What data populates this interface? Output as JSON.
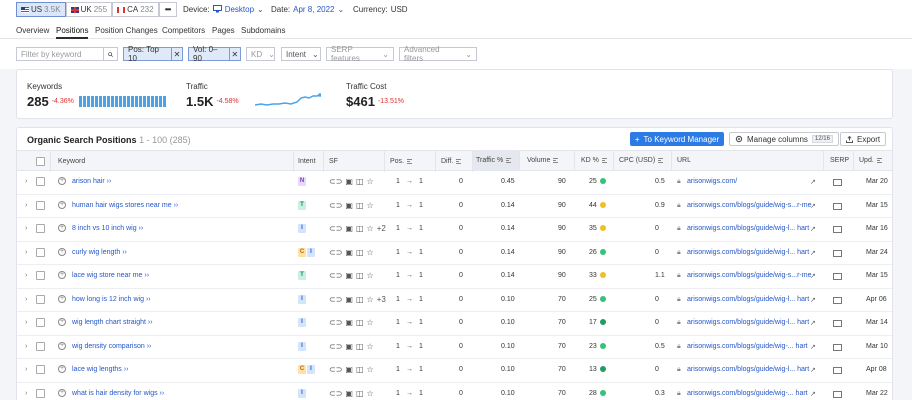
{
  "databases": [
    {
      "code": "US",
      "count": "3.5K",
      "flag": "us",
      "active": true
    },
    {
      "code": "UK",
      "count": "255",
      "flag": "uk",
      "active": false
    },
    {
      "code": "CA",
      "count": "232",
      "flag": "ca",
      "active": false
    }
  ],
  "more_label": "•••",
  "device": {
    "label": "Device:",
    "value": "Desktop"
  },
  "date": {
    "label": "Date:",
    "value": "Apr 8, 2022"
  },
  "currency": {
    "label": "Currency:",
    "value": "USD"
  },
  "tabs": [
    "Overview",
    "Positions",
    "Position Changes",
    "Competitors",
    "Pages",
    "Subdomains"
  ],
  "active_tab": "Positions",
  "filters": {
    "keyword_placeholder": "Filter by keyword",
    "chip_pos": "Pos: Top 10",
    "chip_vol": "Vol: 0–90",
    "kd": "KD",
    "intent": "Intent",
    "serp": "SERP features",
    "advanced": "Advanced filters"
  },
  "summary": {
    "keywords": {
      "label": "Keywords",
      "value": "285",
      "delta": "-4.36%"
    },
    "traffic": {
      "label": "Traffic",
      "value": "1.5K",
      "delta": "-4.58%"
    },
    "traffic_cost": {
      "label": "Traffic Cost",
      "value": "$461",
      "delta": "-13.51%"
    }
  },
  "table": {
    "title": "Organic Search Positions",
    "range": "1 - 100 (285)",
    "manager_btn": "To Keyword Manager",
    "columns_btn": "Manage columns",
    "columns_count": "12/16",
    "export_btn": "Export",
    "headers": {
      "keyword": "Keyword",
      "intent": "Intent",
      "sf": "SF",
      "pos": "Pos.",
      "diff": "Diff.",
      "traffic": "Traffic %",
      "volume": "Volume",
      "kd": "KD %",
      "cpc": "CPC (USD)",
      "url": "URL",
      "serp": "SERP",
      "upd": "Upd."
    },
    "rows": [
      {
        "keyword": "arison hair",
        "intents": [
          "N"
        ],
        "sf_more": "",
        "pos_from": "1",
        "pos_to": "1",
        "diff": "0",
        "traffic": "0.45",
        "volume": "90",
        "kd": "25",
        "kd_color": "#33c479",
        "cpc": "0.5",
        "url": "arisonwigs.com/",
        "upd": "Mar 20"
      },
      {
        "keyword": "human hair wigs stores near me",
        "intents": [
          "T"
        ],
        "sf_more": "",
        "pos_from": "1",
        "pos_to": "1",
        "diff": "0",
        "traffic": "0.14",
        "volume": "90",
        "kd": "44",
        "kd_color": "#f2c023",
        "cpc": "0.9",
        "url": "arisonwigs.com/blogs/guide/wig-s...r-me",
        "upd": "Mar 15"
      },
      {
        "keyword": "8 inch vs 10 inch wig",
        "intents": [
          "I"
        ],
        "sf_more": "+2",
        "pos_from": "1",
        "pos_to": "1",
        "diff": "0",
        "traffic": "0.14",
        "volume": "90",
        "kd": "35",
        "kd_color": "#f2c023",
        "cpc": "0",
        "url": "arisonwigs.com/blogs/guide/wig-l... hart",
        "upd": "Mar 16"
      },
      {
        "keyword": "curly wig length",
        "intents": [
          "C",
          "I"
        ],
        "sf_more": "",
        "pos_from": "1",
        "pos_to": "1",
        "diff": "0",
        "traffic": "0.14",
        "volume": "90",
        "kd": "26",
        "kd_color": "#33c479",
        "cpc": "0",
        "url": "arisonwigs.com/blogs/guide/wig-l... hart",
        "upd": "Mar 24"
      },
      {
        "keyword": "lace wig store near me",
        "intents": [
          "T"
        ],
        "sf_more": "",
        "pos_from": "1",
        "pos_to": "1",
        "diff": "0",
        "traffic": "0.14",
        "volume": "90",
        "kd": "33",
        "kd_color": "#f2c023",
        "cpc": "1.1",
        "url": "arisonwigs.com/blogs/guide/wig-s...r-me",
        "upd": "Mar 15"
      },
      {
        "keyword": "how long is 12 inch wig",
        "intents": [
          "I"
        ],
        "sf_more": "+3",
        "pos_from": "1",
        "pos_to": "1",
        "diff": "0",
        "traffic": "0.10",
        "volume": "70",
        "kd": "25",
        "kd_color": "#33c479",
        "cpc": "0",
        "url": "arisonwigs.com/blogs/guide/wig-l... hart",
        "upd": "Apr 06"
      },
      {
        "keyword": "wig length chart straight",
        "intents": [
          "I"
        ],
        "sf_more": "",
        "pos_from": "1",
        "pos_to": "1",
        "diff": "0",
        "traffic": "0.10",
        "volume": "70",
        "kd": "17",
        "kd_color": "#1f9e5f",
        "cpc": "0",
        "url": "arisonwigs.com/blogs/guide/wig-l... hart",
        "upd": "Mar 14"
      },
      {
        "keyword": "wig density comparison",
        "intents": [
          "I"
        ],
        "sf_more": "",
        "pos_from": "1",
        "pos_to": "1",
        "diff": "0",
        "traffic": "0.10",
        "volume": "70",
        "kd": "23",
        "kd_color": "#33c479",
        "cpc": "0.5",
        "url": "arisonwigs.com/blogs/guide/wig-... hart",
        "upd": "Mar 10"
      },
      {
        "keyword": "lace wig lengths",
        "intents": [
          "C",
          "I"
        ],
        "sf_more": "",
        "pos_from": "1",
        "pos_to": "1",
        "diff": "0",
        "traffic": "0.10",
        "volume": "70",
        "kd": "13",
        "kd_color": "#1f9e5f",
        "cpc": "0",
        "url": "arisonwigs.com/blogs/guide/wig-l... hart",
        "upd": "Apr 08"
      },
      {
        "keyword": "what is hair density for wigs",
        "intents": [
          "I"
        ],
        "sf_more": "",
        "pos_from": "1",
        "pos_to": "1",
        "diff": "0",
        "traffic": "0.10",
        "volume": "70",
        "kd": "28",
        "kd_color": "#33c479",
        "cpc": "0.3",
        "url": "arisonwigs.com/blogs/guide/wig-... hart",
        "upd": "Mar 22"
      }
    ]
  },
  "colors": {
    "accent": "#2c7be5",
    "link": "#2456c8",
    "negative": "#dd3333",
    "kd_easy": "#33c479",
    "kd_medium": "#f2c023",
    "kd_very_easy": "#1f9e5f"
  }
}
